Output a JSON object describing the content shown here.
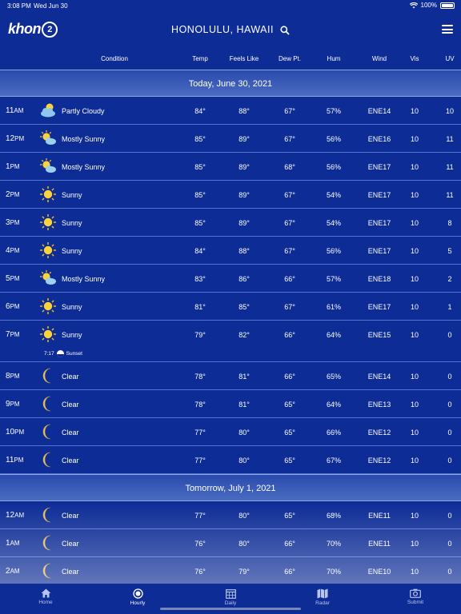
{
  "status_bar": {
    "time": "3:08 PM",
    "date": "Wed Jun 30",
    "battery": "100%"
  },
  "header": {
    "logo": "khon",
    "logo_badge": "2",
    "location": "HONOLULU, HAWAII"
  },
  "columns": {
    "condition": "Condition",
    "temp": "Temp",
    "feels_like": "Feels Like",
    "dew_pt": "Dew Pt.",
    "hum": "Hum",
    "wind": "Wind",
    "vis": "Vis",
    "uv": "UV"
  },
  "days": [
    {
      "label": "Today, June 30, 2021",
      "hours": [
        {
          "h": "11",
          "ap": "AM",
          "icon": "partly-cloudy",
          "cond": "Partly Cloudy",
          "temp": "84°",
          "feels": "88°",
          "dew": "67°",
          "hum": "57%",
          "wind": "ENE14",
          "vis": "10",
          "uv": "10"
        },
        {
          "h": "12",
          "ap": "PM",
          "icon": "mostly-sunny",
          "cond": "Mostly Sunny",
          "temp": "85°",
          "feels": "89°",
          "dew": "67°",
          "hum": "56%",
          "wind": "ENE16",
          "vis": "10",
          "uv": "11"
        },
        {
          "h": "1",
          "ap": "PM",
          "icon": "mostly-sunny",
          "cond": "Mostly Sunny",
          "temp": "85°",
          "feels": "89°",
          "dew": "68°",
          "hum": "56%",
          "wind": "ENE17",
          "vis": "10",
          "uv": "11"
        },
        {
          "h": "2",
          "ap": "PM",
          "icon": "sunny",
          "cond": "Sunny",
          "temp": "85°",
          "feels": "89°",
          "dew": "67°",
          "hum": "54%",
          "wind": "ENE17",
          "vis": "10",
          "uv": "11"
        },
        {
          "h": "3",
          "ap": "PM",
          "icon": "sunny",
          "cond": "Sunny",
          "temp": "85°",
          "feels": "89°",
          "dew": "67°",
          "hum": "54%",
          "wind": "ENE17",
          "vis": "10",
          "uv": "8"
        },
        {
          "h": "4",
          "ap": "PM",
          "icon": "sunny",
          "cond": "Sunny",
          "temp": "84°",
          "feels": "88°",
          "dew": "67°",
          "hum": "56%",
          "wind": "ENE17",
          "vis": "10",
          "uv": "5"
        },
        {
          "h": "5",
          "ap": "PM",
          "icon": "mostly-sunny",
          "cond": "Mostly Sunny",
          "temp": "83°",
          "feels": "86°",
          "dew": "66°",
          "hum": "57%",
          "wind": "ENE18",
          "vis": "10",
          "uv": "2"
        },
        {
          "h": "6",
          "ap": "PM",
          "icon": "sunny",
          "cond": "Sunny",
          "temp": "81°",
          "feels": "85°",
          "dew": "67°",
          "hum": "61%",
          "wind": "ENE17",
          "vis": "10",
          "uv": "1"
        },
        {
          "h": "7",
          "ap": "PM",
          "icon": "sunny",
          "cond": "Sunny",
          "temp": "79°",
          "feels": "82°",
          "dew": "66°",
          "hum": "64%",
          "wind": "ENE15",
          "vis": "10",
          "uv": "0",
          "sunset": {
            "time": "7:17",
            "label": "Sunset"
          }
        },
        {
          "h": "8",
          "ap": "PM",
          "icon": "moon",
          "cond": "Clear",
          "temp": "78°",
          "feels": "81°",
          "dew": "66°",
          "hum": "65%",
          "wind": "ENE14",
          "vis": "10",
          "uv": "0"
        },
        {
          "h": "9",
          "ap": "PM",
          "icon": "moon",
          "cond": "Clear",
          "temp": "78°",
          "feels": "81°",
          "dew": "65°",
          "hum": "64%",
          "wind": "ENE13",
          "vis": "10",
          "uv": "0"
        },
        {
          "h": "10",
          "ap": "PM",
          "icon": "moon",
          "cond": "Clear",
          "temp": "77°",
          "feels": "80°",
          "dew": "65°",
          "hum": "66%",
          "wind": "ENE12",
          "vis": "10",
          "uv": "0"
        },
        {
          "h": "11",
          "ap": "PM",
          "icon": "moon",
          "cond": "Clear",
          "temp": "77°",
          "feels": "80°",
          "dew": "65°",
          "hum": "67%",
          "wind": "ENE12",
          "vis": "10",
          "uv": "0"
        }
      ]
    },
    {
      "label": "Tomorrow, July 1, 2021",
      "hours": [
        {
          "h": "12",
          "ap": "AM",
          "icon": "moon",
          "cond": "Clear",
          "temp": "77°",
          "feels": "80°",
          "dew": "65°",
          "hum": "68%",
          "wind": "ENE11",
          "vis": "10",
          "uv": "0"
        },
        {
          "h": "1",
          "ap": "AM",
          "icon": "moon",
          "cond": "Clear",
          "temp": "76°",
          "feels": "80°",
          "dew": "66°",
          "hum": "70%",
          "wind": "ENE11",
          "vis": "10",
          "uv": "0"
        },
        {
          "h": "2",
          "ap": "AM",
          "icon": "moon",
          "cond": "Clear",
          "temp": "76°",
          "feels": "79°",
          "dew": "66°",
          "hum": "70%",
          "wind": "ENE10",
          "vis": "10",
          "uv": "0"
        }
      ]
    }
  ],
  "tabs": [
    {
      "label": "Home",
      "icon": "home-icon",
      "active": false
    },
    {
      "label": "Hourly",
      "icon": "clock-icon",
      "active": true
    },
    {
      "label": "Daily",
      "icon": "calendar-icon",
      "active": false
    },
    {
      "label": "Radar",
      "icon": "map-icon",
      "active": false
    },
    {
      "label": "Submit",
      "icon": "camera-icon",
      "active": false
    }
  ]
}
